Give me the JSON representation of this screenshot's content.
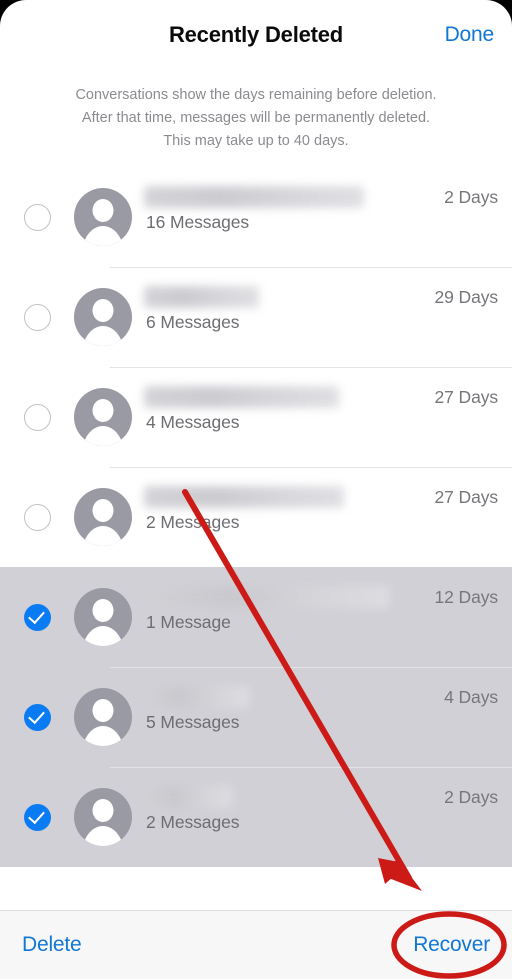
{
  "header": {
    "title": "Recently Deleted",
    "done_label": "Done"
  },
  "description": {
    "line1": "Conversations show the days remaining before deletion.",
    "line2": "After that time, messages will be permanently deleted.",
    "line3": "This may take up to 40 days."
  },
  "list": {
    "unselected_rows": [
      {
        "name": "",
        "messages": "16 Messages",
        "days": "2 Days",
        "checked": "false",
        "name_width": 220
      },
      {
        "name": "",
        "messages": "6 Messages",
        "days": "29 Days",
        "checked": "false",
        "name_width": 115
      },
      {
        "name": "",
        "messages": "4 Messages",
        "days": "27 Days",
        "checked": "false",
        "name_width": 195
      },
      {
        "name": "",
        "messages": "2 Messages",
        "days": "27 Days",
        "checked": "false",
        "name_width": 200
      }
    ],
    "selected_rows": [
      {
        "name": "",
        "messages": "1 Message",
        "days": "12 Days",
        "checked": "true",
        "name_width": 245
      },
      {
        "name": "",
        "messages": "5 Messages",
        "days": "4 Days",
        "checked": "true",
        "name_width": 105
      },
      {
        "name": "",
        "messages": "2 Messages",
        "days": "2 Days",
        "checked": "true",
        "name_width": 88
      }
    ]
  },
  "toolbar": {
    "delete_label": "Delete",
    "recover_label": "Recover"
  },
  "colors": {
    "accent_blue": "#1277d4",
    "checkbox_blue": "#0a7cf3",
    "annotation_red": "#cc1a17",
    "selected_row_background": "#d0d0d6",
    "avatar_grey": "#9a9aa4"
  },
  "annotations": {
    "arrow": "red arrow pointing from list toward Recover button",
    "ellipse": "red ellipse highlighting Recover button"
  }
}
